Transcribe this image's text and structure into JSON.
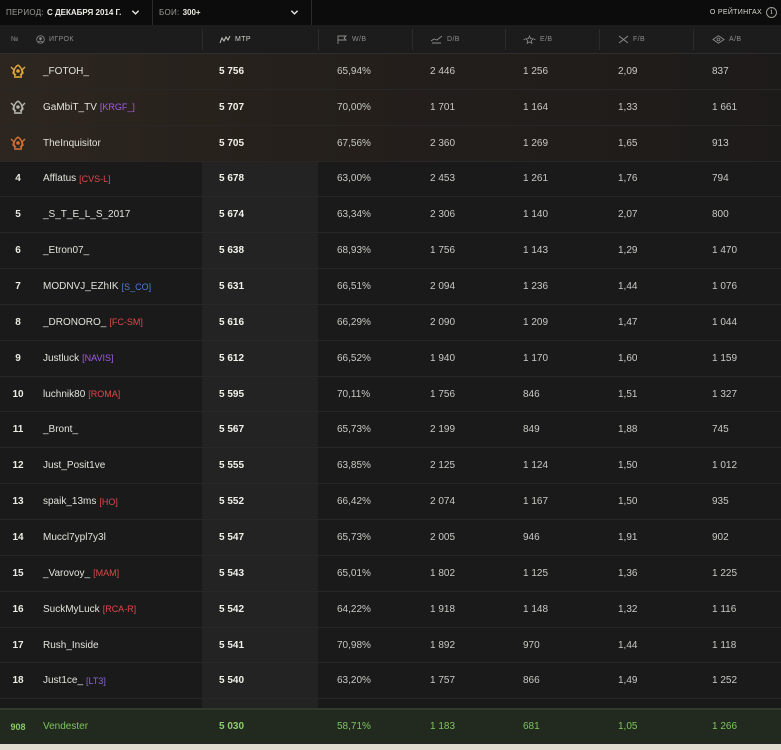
{
  "filters": {
    "period_label": "ПЕРИОД:",
    "period_value": "С ДЕКАБРЯ 2014 Г.",
    "battles_label": "БОИ:",
    "battles_value": "300+"
  },
  "about": {
    "label": "О РЕЙТИНГАХ",
    "icon": "info-icon"
  },
  "columns": {
    "rank": "№",
    "player": "ИГРОК",
    "mtr": "МТР",
    "wb": "W/B",
    "db": "D/B",
    "eb": "E/B",
    "fb": "F/B",
    "ab": "A/B"
  },
  "colors": {
    "gold": "#e0a63b",
    "silver": "#b4b4ae",
    "bronze": "#d26f33",
    "me": "#7ec45f",
    "highlight_column": "#232324"
  },
  "rows": [
    {
      "rank": "1",
      "medal": "gold",
      "name": "_FOTOH_",
      "clan": "",
      "clan_color": "",
      "mtr": "5 756",
      "wb": "65,94%",
      "db": "2 446",
      "eb": "1 256",
      "fb": "2,09",
      "ab": "837"
    },
    {
      "rank": "2",
      "medal": "silver",
      "name": "GaMbiT_TV",
      "clan": "[KRGF_]",
      "clan_color": "#a35be8",
      "mtr": "5 707",
      "wb": "70,00%",
      "db": "1 701",
      "eb": "1 164",
      "fb": "1,33",
      "ab": "1 661"
    },
    {
      "rank": "3",
      "medal": "bronze",
      "name": "TheInquisitor",
      "clan": "",
      "clan_color": "",
      "mtr": "5 705",
      "wb": "67,56%",
      "db": "2 360",
      "eb": "1 269",
      "fb": "1,65",
      "ab": "913"
    },
    {
      "rank": "4",
      "medal": "",
      "name": "Afflatus",
      "clan": "[CVS-L]",
      "clan_color": "#e04848",
      "mtr": "5 678",
      "wb": "63,00%",
      "db": "2 453",
      "eb": "1 261",
      "fb": "1,76",
      "ab": "794"
    },
    {
      "rank": "5",
      "medal": "",
      "name": "_S_T_E_L_S_2017",
      "clan": "",
      "clan_color": "",
      "mtr": "5 674",
      "wb": "63,34%",
      "db": "2 306",
      "eb": "1 140",
      "fb": "2,07",
      "ab": "800"
    },
    {
      "rank": "6",
      "medal": "",
      "name": "_Etron07_",
      "clan": "",
      "clan_color": "",
      "mtr": "5 638",
      "wb": "68,93%",
      "db": "1 756",
      "eb": "1 143",
      "fb": "1,29",
      "ab": "1 470"
    },
    {
      "rank": "7",
      "medal": "",
      "name": "MODNVJ_EZhIK",
      "clan": "[S_CO]",
      "clan_color": "#4d7fd6",
      "mtr": "5 631",
      "wb": "66,51%",
      "db": "2 094",
      "eb": "1 236",
      "fb": "1,44",
      "ab": "1 076"
    },
    {
      "rank": "8",
      "medal": "",
      "name": "_DRONORO_",
      "clan": "[FC-SM]",
      "clan_color": "#e04848",
      "mtr": "5 616",
      "wb": "66,29%",
      "db": "2 090",
      "eb": "1 209",
      "fb": "1,47",
      "ab": "1 044"
    },
    {
      "rank": "9",
      "medal": "",
      "name": "Justluck",
      "clan": "[NAVIS]",
      "clan_color": "#a35be8",
      "mtr": "5 612",
      "wb": "66,52%",
      "db": "1 940",
      "eb": "1 170",
      "fb": "1,60",
      "ab": "1 159"
    },
    {
      "rank": "10",
      "medal": "",
      "name": "luchnik80",
      "clan": "[ROMA]",
      "clan_color": "#e04848",
      "mtr": "5 595",
      "wb": "70,11%",
      "db": "1 756",
      "eb": "846",
      "fb": "1,51",
      "ab": "1 327"
    },
    {
      "rank": "11",
      "medal": "",
      "name": "_Bront_",
      "clan": "",
      "clan_color": "",
      "mtr": "5 567",
      "wb": "65,73%",
      "db": "2 199",
      "eb": "849",
      "fb": "1,88",
      "ab": "745"
    },
    {
      "rank": "12",
      "medal": "",
      "name": "Just_Posit1ve",
      "clan": "",
      "clan_color": "",
      "mtr": "5 555",
      "wb": "63,85%",
      "db": "2 125",
      "eb": "1 124",
      "fb": "1,50",
      "ab": "1 012"
    },
    {
      "rank": "13",
      "medal": "",
      "name": "spaik_13ms",
      "clan": "[HO]",
      "clan_color": "#e04848",
      "mtr": "5 552",
      "wb": "66,42%",
      "db": "2 074",
      "eb": "1 167",
      "fb": "1,50",
      "ab": "935"
    },
    {
      "rank": "14",
      "medal": "",
      "name": "Muccl7ypl7y3l",
      "clan": "",
      "clan_color": "",
      "mtr": "5 547",
      "wb": "65,73%",
      "db": "2 005",
      "eb": "946",
      "fb": "1,91",
      "ab": "902"
    },
    {
      "rank": "15",
      "medal": "",
      "name": "_Varovoy_",
      "clan": "[MAM]",
      "clan_color": "#e04848",
      "mtr": "5 543",
      "wb": "65,01%",
      "db": "1 802",
      "eb": "1 125",
      "fb": "1,36",
      "ab": "1 225"
    },
    {
      "rank": "16",
      "medal": "",
      "name": "SuckMyLuck",
      "clan": "[RCA-R]",
      "clan_color": "#e04848",
      "mtr": "5 542",
      "wb": "64,22%",
      "db": "1 918",
      "eb": "1 148",
      "fb": "1,32",
      "ab": "1 116"
    },
    {
      "rank": "17",
      "medal": "",
      "name": "Rush_Inside",
      "clan": "",
      "clan_color": "",
      "mtr": "5 541",
      "wb": "70,98%",
      "db": "1 892",
      "eb": "970",
      "fb": "1,44",
      "ab": "1 118"
    },
    {
      "rank": "18",
      "medal": "",
      "name": "Just1ce_",
      "clan": "[LT3]",
      "clan_color": "#8a63d6",
      "mtr": "5 540",
      "wb": "63,20%",
      "db": "1 757",
      "eb": "866",
      "fb": "1,49",
      "ab": "1 252"
    }
  ],
  "current_player": {
    "rank": "908",
    "name": "Vendester",
    "mtr": "5 030",
    "wb": "58,71%",
    "db": "1 183",
    "eb": "681",
    "fb": "1,05",
    "ab": "1 266"
  }
}
